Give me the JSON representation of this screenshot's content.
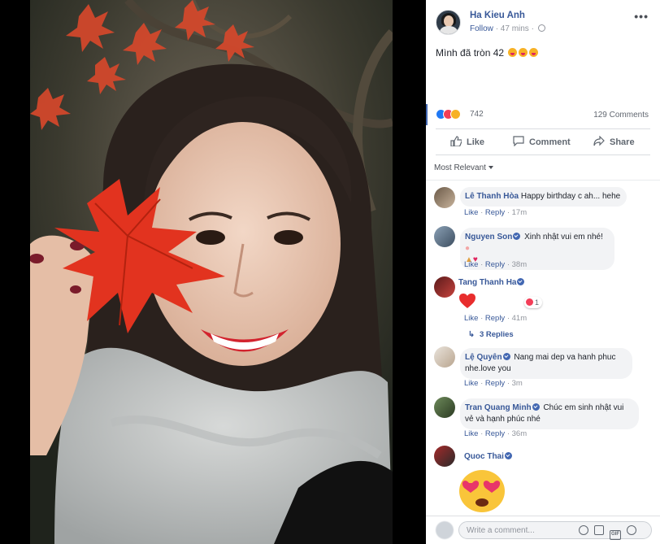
{
  "post": {
    "author": "Ha Kieu Anh",
    "follow": "Follow",
    "time": "47 mins",
    "text": "Mình đã tròn 42",
    "reaction_count": "742",
    "comments_count": "129 Comments"
  },
  "actions": {
    "like": "Like",
    "comment": "Comment",
    "share": "Share"
  },
  "sort_label": "Most Relevant",
  "comments": [
    {
      "name": "Lê Thanh Hòa",
      "text": "Happy birthday c ah... hehe",
      "like": "Like",
      "reply": "Reply",
      "time": "17m"
    },
    {
      "name": "Nguyen Son",
      "text": "Xinh nhật vui em nhé!",
      "like": "Like",
      "reply": "Reply",
      "time": "38m"
    },
    {
      "name": "Tang Thanh Ha",
      "text": "",
      "like": "Like",
      "reply": "Reply",
      "time": "41m",
      "reaction_count": "1",
      "replies": "3 Replies"
    },
    {
      "name": "Lệ Quyên",
      "text": "Nang mai dep va hanh phuc nhe.love you",
      "like": "Like",
      "reply": "Reply",
      "time": "3m"
    },
    {
      "name": "Tran Quang Minh",
      "text": "Chúc em sinh nhật vui vẻ và hạnh phúc nhé",
      "like": "Like",
      "reply": "Reply",
      "time": "36m"
    },
    {
      "name": "Quoc Thai",
      "text": ""
    }
  ],
  "composer": {
    "placeholder": "Write a comment..."
  },
  "icons": {
    "more": "more-icon",
    "globe": "globe-icon",
    "like": "thumbs-up-icon",
    "comment": "speech-bubble-icon",
    "share": "share-arrow-icon",
    "emoji": "smiley-icon",
    "camera": "camera-icon",
    "gif": "gif-icon",
    "sticker": "sticker-icon"
  },
  "colors": {
    "link": "#385898",
    "like": "#2078f4",
    "love": "#f33e58",
    "haha": "#f7b125",
    "bubble": "#f2f3f5"
  }
}
